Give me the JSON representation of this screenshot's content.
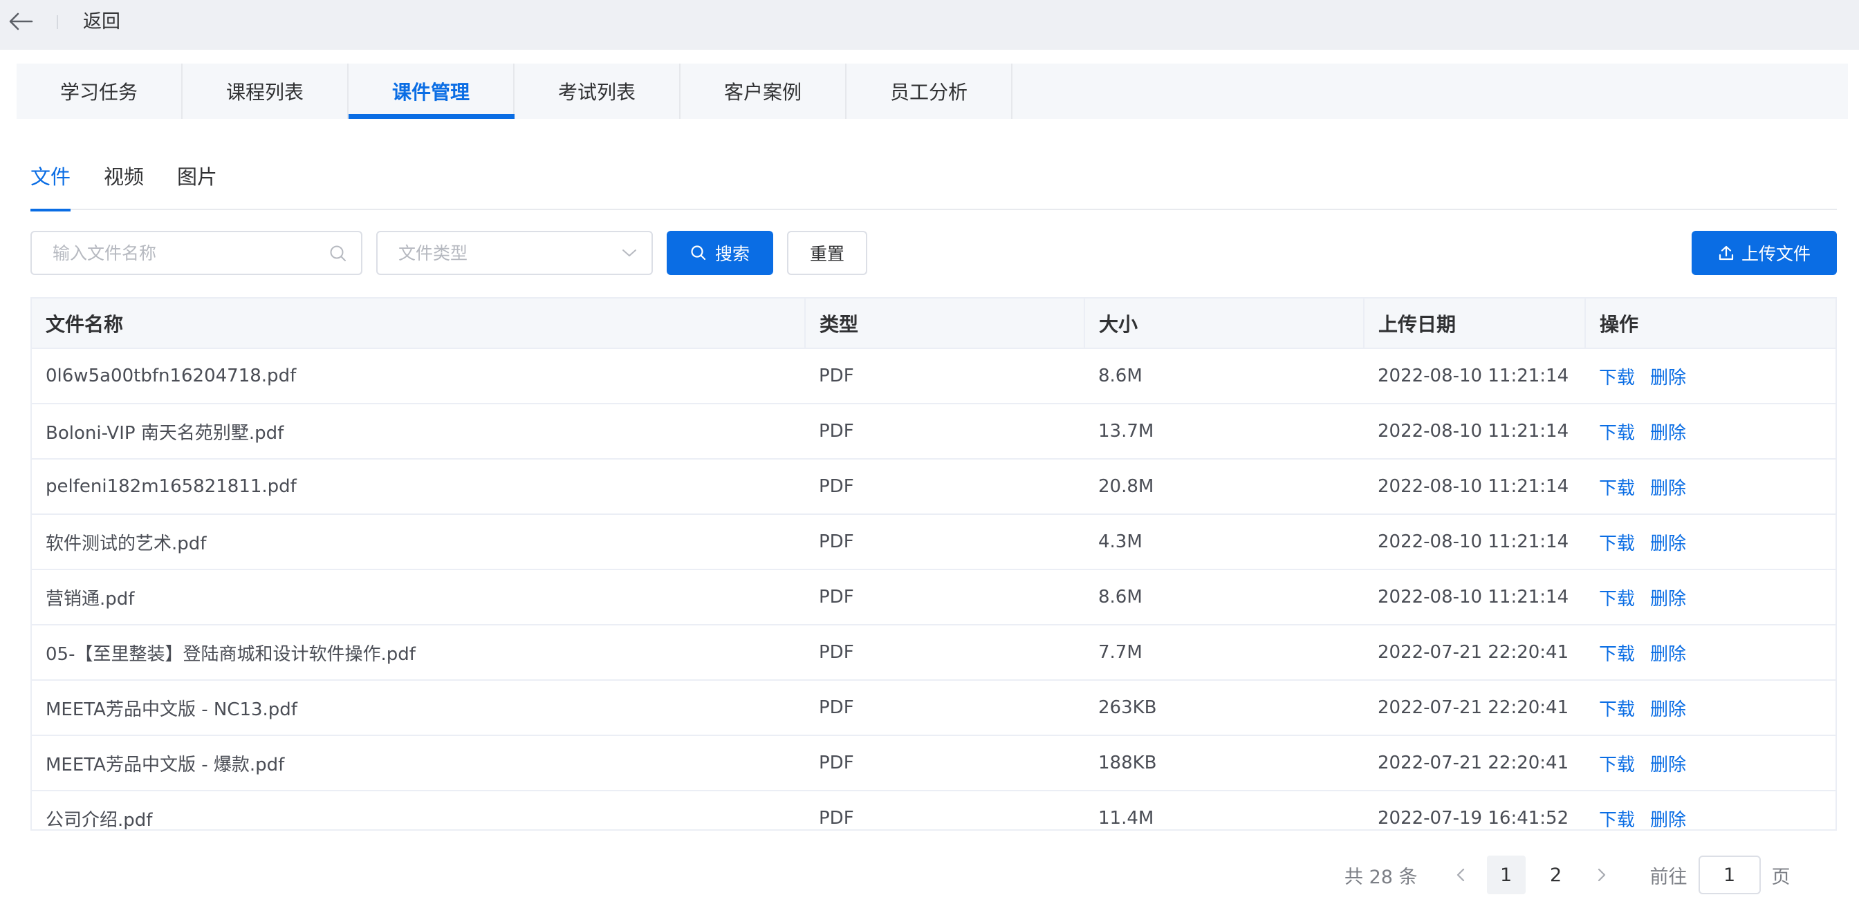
{
  "topbar": {
    "back_label": "返回"
  },
  "main_tabs": [
    {
      "label": "学习任务"
    },
    {
      "label": "课程列表"
    },
    {
      "label": "课件管理"
    },
    {
      "label": "考试列表"
    },
    {
      "label": "客户案例"
    },
    {
      "label": "员工分析"
    }
  ],
  "main_tabs_active": 2,
  "sub_tabs": [
    {
      "label": "文件"
    },
    {
      "label": "视频"
    },
    {
      "label": "图片"
    }
  ],
  "sub_tabs_active": 0,
  "filters": {
    "name_placeholder": "输入文件名称",
    "name_value": "",
    "type_placeholder": "文件类型",
    "search_label": "搜索",
    "reset_label": "重置",
    "upload_label": "上传文件"
  },
  "table": {
    "columns": [
      "文件名称",
      "类型",
      "大小",
      "上传日期",
      "操作"
    ],
    "rows": [
      {
        "name": "0l6w5a00tbfn16204718.pdf",
        "type": "PDF",
        "size": "8.6M",
        "date": "2022-08-10 11:21:14"
      },
      {
        "name": "Boloni-VIP 南天名苑别墅.pdf",
        "type": "PDF",
        "size": "13.7M",
        "date": "2022-08-10 11:21:14"
      },
      {
        "name": "pelfeni182m165821811.pdf",
        "type": "PDF",
        "size": "20.8M",
        "date": "2022-08-10 11:21:14"
      },
      {
        "name": "软件测试的艺术.pdf",
        "type": "PDF",
        "size": "4.3M",
        "date": "2022-08-10 11:21:14"
      },
      {
        "name": "营销通.pdf",
        "type": "PDF",
        "size": "8.6M",
        "date": "2022-08-10 11:21:14"
      },
      {
        "name": "05-【至里整装】登陆商城和设计软件操作.pdf",
        "type": "PDF",
        "size": "7.7M",
        "date": "2022-07-21 22:20:41"
      },
      {
        "name": "MEETA芳品中文版 - NC13.pdf",
        "type": "PDF",
        "size": "263KB",
        "date": "2022-07-21 22:20:41"
      },
      {
        "name": "MEETA芳品中文版 - 爆款.pdf",
        "type": "PDF",
        "size": "188KB",
        "date": "2022-07-21 22:20:41"
      },
      {
        "name": "公司介绍.pdf",
        "type": "PDF",
        "size": "11.4M",
        "date": "2022-07-19 16:41:52"
      }
    ],
    "action_download": "下载",
    "action_delete": "删除"
  },
  "pagination": {
    "total_text": "共 28 条",
    "pages": [
      "1",
      "2"
    ],
    "current_page": "1",
    "goto_label": "前往",
    "goto_value": "1",
    "page_suffix": "页"
  },
  "colors": {
    "accent": "#0a6de4",
    "topbar_bg": "#eef0f4",
    "header_bg": "#f5f7fa"
  },
  "icons": {
    "back": "arrow-left-icon",
    "search_field": "search-icon",
    "select": "chevron-down-icon",
    "search_button": "search-icon",
    "upload": "upload-icon",
    "prev": "chevron-left-icon",
    "next": "chevron-right-icon"
  }
}
